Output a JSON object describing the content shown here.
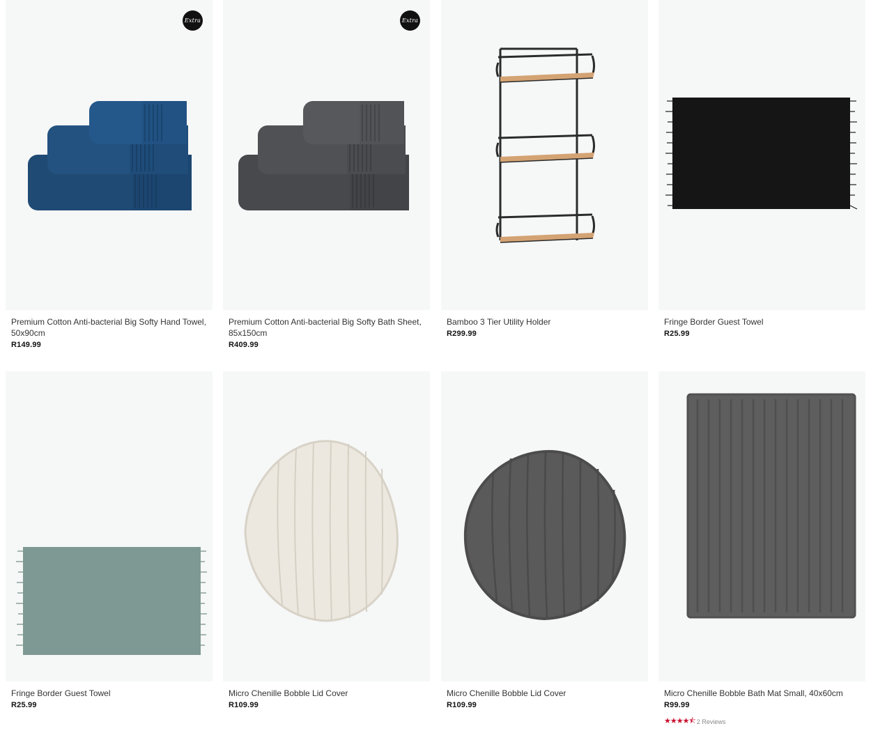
{
  "products": [
    {
      "title": "Premium Cotton Anti-bacterial Big Softy Hand Towel, 50x90cm",
      "price": "R149.99",
      "badge": "Extra",
      "image": "navy-towel-stack"
    },
    {
      "title": "Premium Cotton Anti-bacterial Big Softy Bath Sheet, 85x150cm",
      "price": "R409.99",
      "badge": "Extra",
      "image": "charcoal-towel-stack"
    },
    {
      "title": "Bamboo 3 Tier Utility Holder",
      "price": "R299.99",
      "image": "bamboo-shelf"
    },
    {
      "title": "Fringe Border Guest Towel",
      "price": "R25.99",
      "image": "black-fringe-towel"
    },
    {
      "title": "Fringe Border Guest Towel",
      "price": "R25.99",
      "image": "sage-fringe-towel"
    },
    {
      "title": "Micro Chenille Bobble Lid Cover",
      "price": "R109.99",
      "image": "cream-lid-cover"
    },
    {
      "title": "Micro Chenille Bobble Lid Cover",
      "price": "R109.99",
      "image": "grey-lid-cover"
    },
    {
      "title": "Micro Chenille Bobble Bath Mat Small, 40x60cm",
      "price": "R99.99",
      "image": "grey-bath-mat",
      "rating": {
        "stars": 4.5,
        "reviews_label": "2 Reviews"
      }
    }
  ],
  "colors": {
    "accent_star": "#c8102e",
    "image_bg": "#f6f7f7"
  }
}
